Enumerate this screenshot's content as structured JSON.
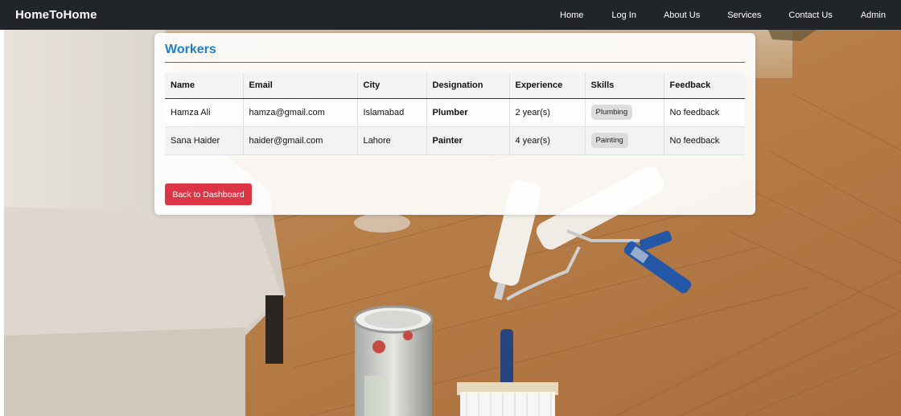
{
  "navbar": {
    "brand": "HomeToHome",
    "links": [
      "Home",
      "Log In",
      "About Us",
      "Services",
      "Contact Us",
      "Admin"
    ]
  },
  "card": {
    "title": "Workers",
    "table": {
      "headers": [
        "Name",
        "Email",
        "City",
        "Designation",
        "Experience",
        "Skills",
        "Feedback"
      ],
      "rows": [
        {
          "name": "Hamza Ali",
          "email": "hamza@gmail.com",
          "city": "Islamabad",
          "designation": "Plumber",
          "experience": "2 year(s)",
          "skills": "Plumbing",
          "feedback": "No feedback"
        },
        {
          "name": "Sana Haider",
          "email": "haider@gmail.com",
          "city": "Lahore",
          "designation": "Painter",
          "experience": "4 year(s)",
          "skills": "Painting",
          "feedback": "No feedback"
        }
      ]
    },
    "back_button_label": "Back to Dashboard"
  },
  "colors": {
    "navbar_bg": "#212529",
    "title_accent": "#1f7ec9",
    "button_danger": "#dc3545",
    "floor_wood": "#b9824f"
  },
  "background_image": "painting-tools-on-wooden-floor"
}
